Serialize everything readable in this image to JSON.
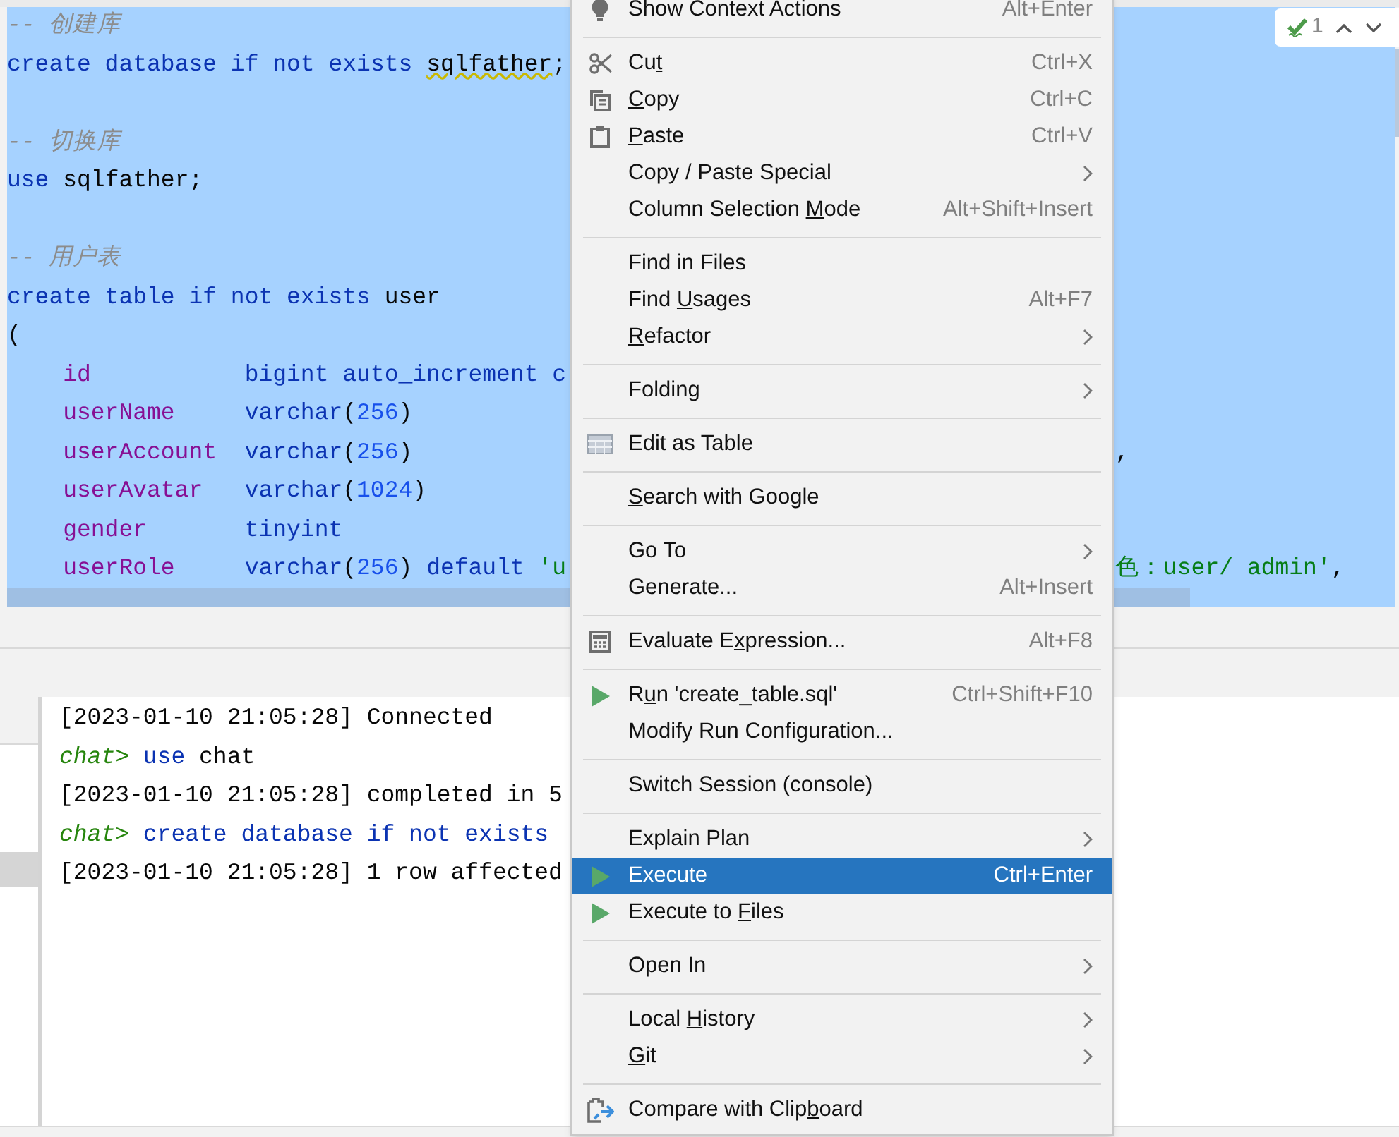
{
  "editor": {
    "lines": [
      {
        "kind": "code",
        "tokens": [
          {
            "text": "-- 创建库",
            "kind": "comment"
          }
        ]
      },
      {
        "kind": "code",
        "tokens": [
          {
            "text": "create database if not exists ",
            "kind": "keyword"
          },
          {
            "text": "sqlfather",
            "kind": "plain",
            "warning": true
          },
          {
            "text": ";",
            "kind": "plain"
          }
        ]
      },
      {
        "kind": "blank"
      },
      {
        "kind": "code",
        "tokens": [
          {
            "text": "-- 切换库",
            "kind": "comment"
          }
        ]
      },
      {
        "kind": "code",
        "tokens": [
          {
            "text": "use ",
            "kind": "keyword"
          },
          {
            "text": "sqlfather;",
            "kind": "plain"
          }
        ]
      },
      {
        "kind": "blank"
      },
      {
        "kind": "code",
        "tokens": [
          {
            "text": "-- 用户表",
            "kind": "comment"
          }
        ]
      },
      {
        "kind": "code",
        "tokens": [
          {
            "text": "create table if not exists ",
            "kind": "keyword"
          },
          {
            "text": "user",
            "kind": "plain"
          }
        ]
      },
      {
        "kind": "code",
        "tokens": [
          {
            "text": "(",
            "kind": "plain"
          }
        ]
      },
      {
        "kind": "column",
        "field": "id",
        "tokens": [
          {
            "text": "bigint auto_increment c",
            "kind": "keyword"
          }
        ]
      },
      {
        "kind": "column",
        "field": "userName",
        "tokens": [
          {
            "text": "varchar",
            "kind": "keyword"
          },
          {
            "text": "(",
            "kind": "plain"
          },
          {
            "text": "256",
            "kind": "number"
          },
          {
            "text": ")",
            "kind": "plain"
          }
        ]
      },
      {
        "kind": "column",
        "field": "userAccount",
        "tokens": [
          {
            "text": "varchar",
            "kind": "keyword"
          },
          {
            "text": "(",
            "kind": "plain"
          },
          {
            "text": "256",
            "kind": "number"
          },
          {
            "text": ")",
            "kind": "plain"
          }
        ],
        "tail": [
          {
            "text": ",",
            "kind": "plain"
          }
        ]
      },
      {
        "kind": "column",
        "field": "userAvatar",
        "tokens": [
          {
            "text": "varchar",
            "kind": "keyword"
          },
          {
            "text": "(",
            "kind": "plain"
          },
          {
            "text": "1024",
            "kind": "number"
          },
          {
            "text": ")",
            "kind": "plain"
          }
        ]
      },
      {
        "kind": "column",
        "field": "gender",
        "tokens": [
          {
            "text": "tinyint",
            "kind": "keyword"
          }
        ]
      },
      {
        "kind": "column",
        "field": "userRole",
        "tokens": [
          {
            "text": "varchar",
            "kind": "keyword"
          },
          {
            "text": "(",
            "kind": "plain"
          },
          {
            "text": "256",
            "kind": "number"
          },
          {
            "text": ") ",
            "kind": "plain"
          },
          {
            "text": "default ",
            "kind": "keyword"
          },
          {
            "text": "'u",
            "kind": "string"
          }
        ],
        "tail": [
          {
            "text": "色：user/ admin'",
            "kind": "string"
          },
          {
            "text": ",",
            "kind": "plain"
          }
        ]
      }
    ],
    "inspection": {
      "count": "1"
    }
  },
  "console": {
    "lines": [
      {
        "kind": "code",
        "tokens": [
          {
            "text": "[2023-01-10 21:05:28] Connected",
            "kind": "plain"
          }
        ]
      },
      {
        "kind": "code",
        "tokens": [
          {
            "text": "chat>",
            "kind": "prompt"
          },
          {
            "text": " use ",
            "kind": "keyword"
          },
          {
            "text": "chat",
            "kind": "plain"
          }
        ]
      },
      {
        "kind": "code",
        "tokens": [
          {
            "text": "[2023-01-10 21:05:28] completed in 5",
            "kind": "plain"
          }
        ]
      },
      {
        "kind": "code",
        "tokens": [
          {
            "text": "chat>",
            "kind": "prompt"
          },
          {
            "text": " create database if not exists",
            "kind": "keyword"
          }
        ]
      },
      {
        "kind": "code",
        "tokens": [
          {
            "text": "[2023-01-10 21:05:28] 1 row affected",
            "kind": "plain"
          }
        ]
      }
    ]
  },
  "context_menu": {
    "groups": [
      [
        {
          "label": "Show Context Actions",
          "shortcut": "Alt+Enter",
          "kind": "bulb",
          "submenu": false,
          "selected": false
        }
      ],
      [
        {
          "label": {
            "before": "Cu",
            "key": "t"
          },
          "shortcut": "Ctrl+X",
          "kind": "scissors",
          "submenu": false,
          "selected": false
        },
        {
          "label": {
            "key": "C",
            "after": "opy"
          },
          "shortcut": "Ctrl+C",
          "kind": "copy",
          "submenu": false,
          "selected": false
        },
        {
          "label": {
            "key": "P",
            "after": "aste"
          },
          "shortcut": "Ctrl+V",
          "kind": "clipboard",
          "submenu": false,
          "selected": false
        },
        {
          "label": "Copy / Paste Special",
          "kind": "plain",
          "submenu": true,
          "selected": false
        },
        {
          "label": {
            "before": "Column Selection ",
            "key": "M",
            "after": "ode"
          },
          "shortcut": "Alt+Shift+Insert",
          "kind": "plain",
          "submenu": false,
          "selected": false
        }
      ],
      [
        {
          "label": "Find in Files",
          "kind": "plain",
          "submenu": false,
          "selected": false
        },
        {
          "label": {
            "before": "Find ",
            "key": "U",
            "after": "sages"
          },
          "shortcut": "Alt+F7",
          "kind": "plain",
          "submenu": false,
          "selected": false
        },
        {
          "label": {
            "key": "R",
            "after": "efactor"
          },
          "kind": "plain",
          "submenu": true,
          "selected": false
        }
      ],
      [
        {
          "label": "Folding",
          "kind": "plain",
          "submenu": true,
          "selected": false
        }
      ],
      [
        {
          "label": "Edit as Table",
          "kind": "table",
          "submenu": false,
          "selected": false
        }
      ],
      [
        {
          "label": {
            "key": "S",
            "after": "earch with Google"
          },
          "kind": "plain",
          "submenu": false,
          "selected": false
        }
      ],
      [
        {
          "label": "Go To",
          "kind": "plain",
          "submenu": true,
          "selected": false
        },
        {
          "label": "Generate...",
          "shortcut": "Alt+Insert",
          "kind": "plain",
          "submenu": false,
          "selected": false
        }
      ],
      [
        {
          "label": {
            "before": "Evaluate E",
            "key": "x",
            "after": "pression..."
          },
          "shortcut": "Alt+F8",
          "kind": "calculator",
          "submenu": false,
          "selected": false
        }
      ],
      [
        {
          "label": {
            "before": "R",
            "key": "u",
            "after": "n 'create_table.sql'"
          },
          "shortcut": "Ctrl+Shift+F10",
          "kind": "run",
          "submenu": false,
          "selected": false
        },
        {
          "label": "Modify Run Configuration...",
          "kind": "plain",
          "submenu": false,
          "selected": false
        }
      ],
      [
        {
          "label": "Switch Session (console)",
          "kind": "plain",
          "submenu": false,
          "selected": false
        }
      ],
      [
        {
          "label": "Explain Plan",
          "kind": "plain",
          "submenu": true,
          "selected": false
        },
        {
          "label": "Execute",
          "shortcut": "Ctrl+Enter",
          "kind": "run",
          "submenu": false,
          "selected": true
        },
        {
          "label": {
            "before": "Execute to ",
            "key": "F",
            "after": "iles"
          },
          "kind": "run",
          "submenu": false,
          "selected": false
        }
      ],
      [
        {
          "label": "Open In",
          "kind": "plain",
          "submenu": true,
          "selected": false
        }
      ],
      [
        {
          "label": {
            "before": "Local ",
            "key": "H",
            "after": "istory"
          },
          "kind": "plain",
          "submenu": true,
          "selected": false
        },
        {
          "label": {
            "key": "G",
            "after": "it"
          },
          "kind": "plain",
          "submenu": true,
          "selected": false
        }
      ],
      [
        {
          "label": {
            "before": "Compare with Clip",
            "key": "b",
            "after": "oard"
          },
          "kind": "compare",
          "submenu": false,
          "selected": false
        }
      ]
    ]
  }
}
